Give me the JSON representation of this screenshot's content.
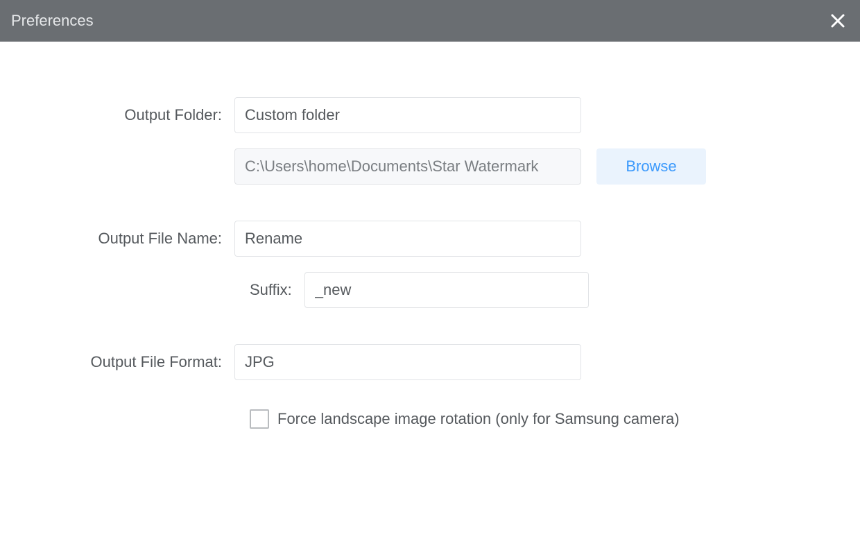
{
  "titlebar": {
    "title": "Preferences"
  },
  "form": {
    "outputFolder": {
      "label": "Output Folder:",
      "value": "Custom folder",
      "path": "C:\\Users\\home\\Documents\\Star Watermark",
      "browse": "Browse"
    },
    "outputFileName": {
      "label": "Output File Name:",
      "value": "Rename",
      "suffixLabel": "Suffix:",
      "suffixValue": "_new"
    },
    "outputFileFormat": {
      "label": "Output File Format:",
      "value": "JPG"
    },
    "forceLandscape": {
      "label": "Force landscape image rotation (only for Samsung camera)",
      "checked": false
    }
  }
}
